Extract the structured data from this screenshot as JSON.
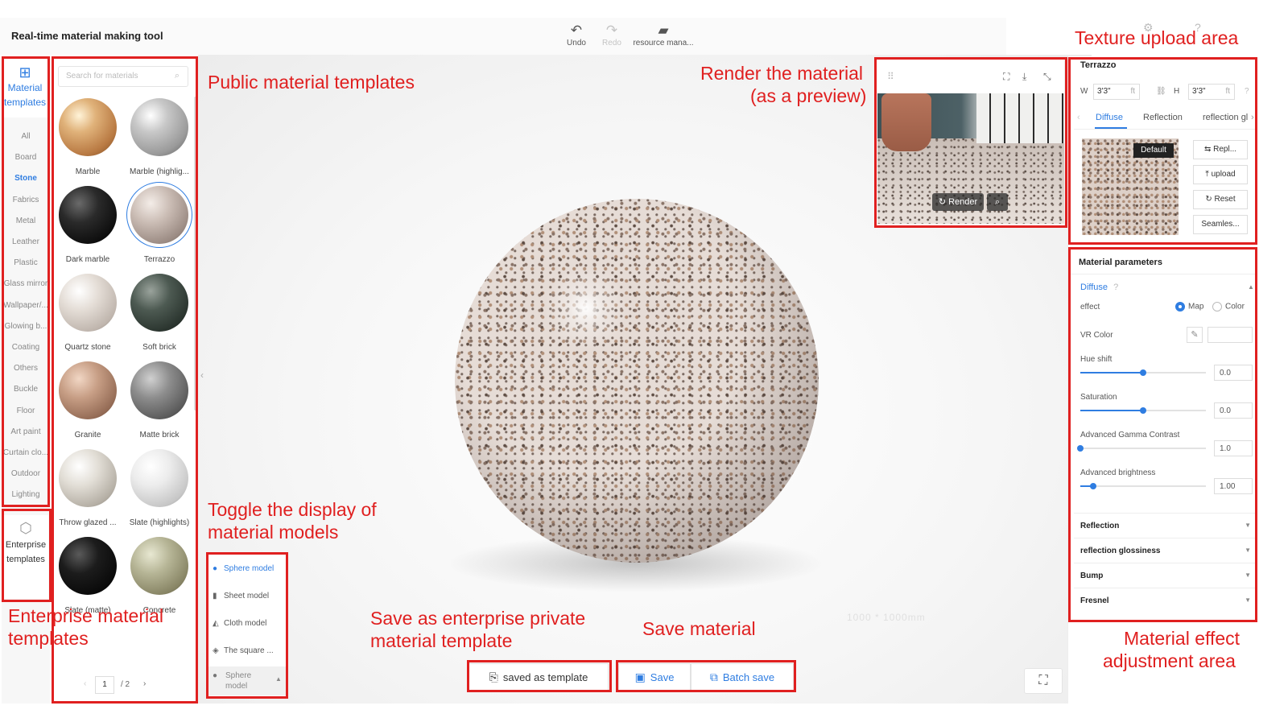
{
  "header": {
    "app_title": "Real-time material making tool",
    "tools": [
      {
        "label": "Undo",
        "icon": "undo-icon",
        "glyph": "↶",
        "enabled": true
      },
      {
        "label": "Redo",
        "icon": "redo-icon",
        "glyph": "↷",
        "enabled": false
      },
      {
        "label": "resource mana...",
        "icon": "folder-icon",
        "glyph": "▰",
        "enabled": true
      }
    ]
  },
  "left_rail": {
    "material_templates_label": "Material templates",
    "categories": [
      "All",
      "Board",
      "Stone",
      "Fabrics",
      "Metal",
      "Leather",
      "Plastic",
      "Glass mirror",
      "Wallpaper/...",
      "Glowing b...",
      "Coating",
      "Others",
      "Buckle",
      "Floor",
      "Art paint",
      "Curtain clo...",
      "Outdoor",
      "Lighting"
    ],
    "active_category": "Stone",
    "enterprise_templates_label": "Enterprise templates"
  },
  "materials": {
    "search_placeholder": "Search for materials",
    "items": [
      {
        "name": "Marble"
      },
      {
        "name": "Marble (highlig..."
      },
      {
        "name": "Dark marble"
      },
      {
        "name": "Terrazzo",
        "selected": true
      },
      {
        "name": "Quartz stone"
      },
      {
        "name": "Soft brick"
      },
      {
        "name": "Granite"
      },
      {
        "name": "Matte brick"
      },
      {
        "name": "Throw glazed ..."
      },
      {
        "name": "Slate (highlights)"
      },
      {
        "name": "Slate (matte)"
      },
      {
        "name": "Concrete"
      },
      {
        "name": ""
      },
      {
        "name": ""
      }
    ],
    "pager": {
      "current": "1",
      "total": "/ 2"
    }
  },
  "model_toggle": {
    "options": [
      {
        "label": "Sphere model",
        "icon": "sphere-icon",
        "glyph": "●",
        "active": true
      },
      {
        "label": "Sheet model",
        "icon": "sheet-icon",
        "glyph": "▮"
      },
      {
        "label": "Cloth model",
        "icon": "cloth-icon",
        "glyph": "◭"
      },
      {
        "label": "The square ...",
        "icon": "cube-icon",
        "glyph": "◈"
      }
    ],
    "selected": "Sphere model"
  },
  "viewport": {
    "watermark": "1000 * 1000mm"
  },
  "bottom_bar": {
    "saved_template": "saved as template",
    "save": "Save",
    "batch_save": "Batch save"
  },
  "preview": {
    "render_label": "Render"
  },
  "right_panel": {
    "material_name": "Terrazzo",
    "width_label": "W",
    "width_value": "3'3\"",
    "height_label": "H",
    "height_value": "3'3\"",
    "unit": "ft",
    "tabs": [
      "Diffuse",
      "Reflection",
      "reflection gl"
    ],
    "active_tab": "Diffuse",
    "default_badge": "Default",
    "buttons": [
      "Repl...",
      "upload",
      "Reset",
      "Seamles..."
    ],
    "parameters_title": "Material parameters",
    "diffuse_section": "Diffuse",
    "effect_label": "effect",
    "effect_options": [
      "Map",
      "Color"
    ],
    "effect_selected": "Map",
    "vr_color_label": "VR Color",
    "sliders": [
      {
        "label": "Hue shift",
        "value": "0.0",
        "fraction": 0.5
      },
      {
        "label": "Saturation",
        "value": "0.0",
        "fraction": 0.5
      },
      {
        "label": "Advanced Gamma Contrast",
        "value": "1.0",
        "fraction": 0.0
      },
      {
        "label": "Advanced brightness",
        "value": "1.00",
        "fraction": 0.1
      }
    ],
    "sections": [
      "Reflection",
      "reflection glossiness",
      "Bump",
      "Fresnel"
    ]
  },
  "annotations": {
    "public_templates": "Public material templates",
    "render_line1": "Render the material",
    "render_line2": "(as a preview)",
    "texture_upload": "Texture upload area",
    "toggle_line1": "Toggle the display of",
    "toggle_line2": "material models",
    "enterprise_line1": "Enterprise material",
    "enterprise_line2": "templates",
    "save_template_line1": "Save as enterprise private",
    "save_template_line2": "material template",
    "save_material": "Save material",
    "effect_line1": "Material effect",
    "effect_line2": "adjustment area"
  },
  "colors": {
    "accent": "#2f7de1",
    "annotation": "#e02020"
  }
}
